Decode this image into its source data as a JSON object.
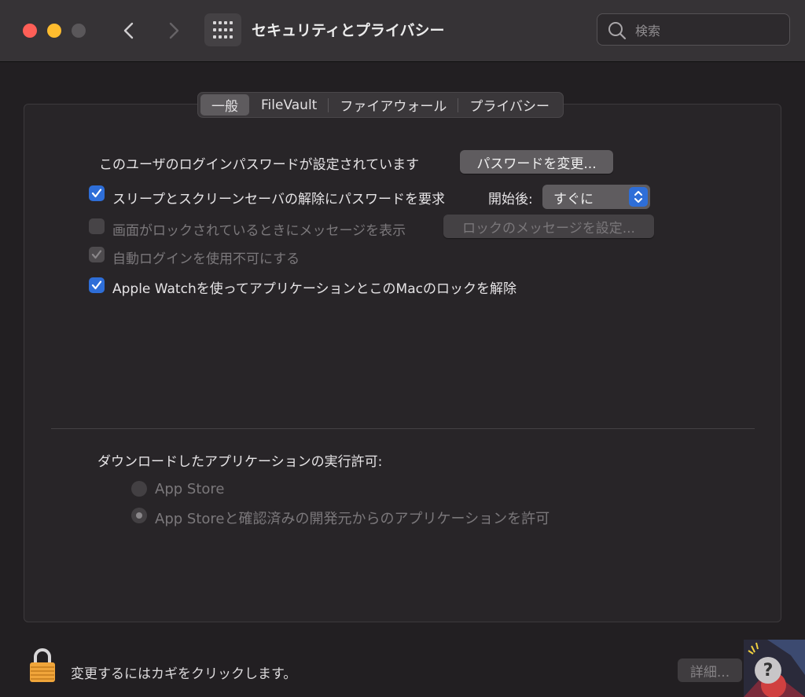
{
  "window": {
    "title": "セキュリティとプライバシー"
  },
  "search": {
    "placeholder": "検索"
  },
  "tabs": [
    {
      "label": "一般",
      "active": true
    },
    {
      "label": "FileVault",
      "active": false
    },
    {
      "label": "ファイアウォール",
      "active": false
    },
    {
      "label": "プライバシー",
      "active": false
    }
  ],
  "general": {
    "login_password_text": "このユーザのログインパスワードが設定されています",
    "change_password_button": "パスワードを変更...",
    "require_password": {
      "label": "スリープとスクリーンセーバの解除にパスワードを要求",
      "checked": true
    },
    "start_after_label": "開始後:",
    "start_after_value": "すぐに",
    "show_message": {
      "label": "画面がロックされているときにメッセージを表示",
      "checked": false,
      "enabled": false
    },
    "set_lock_message_button": "ロックのメッセージを設定...",
    "disable_auto_login": {
      "label": "自動ログインを使用不可にする",
      "checked": true,
      "enabled": false
    },
    "apple_watch_unlock": {
      "label": "Apple Watchを使ってアプリケーションとこのMacのロックを解除",
      "checked": true
    }
  },
  "downloads": {
    "heading": "ダウンロードしたアプリケーションの実行許可:",
    "options": [
      {
        "label": "App Store",
        "selected": false
      },
      {
        "label": "App Storeと確認済みの開発元からのアプリケーションを許可",
        "selected": true
      }
    ]
  },
  "footer": {
    "lock_text": "変更するにはカギをクリックします。",
    "details_button": "詳細...",
    "help_button": "?"
  },
  "colors": {
    "accent": "#2e6ed8",
    "background": "#221f22",
    "titlebar": "#363336"
  }
}
